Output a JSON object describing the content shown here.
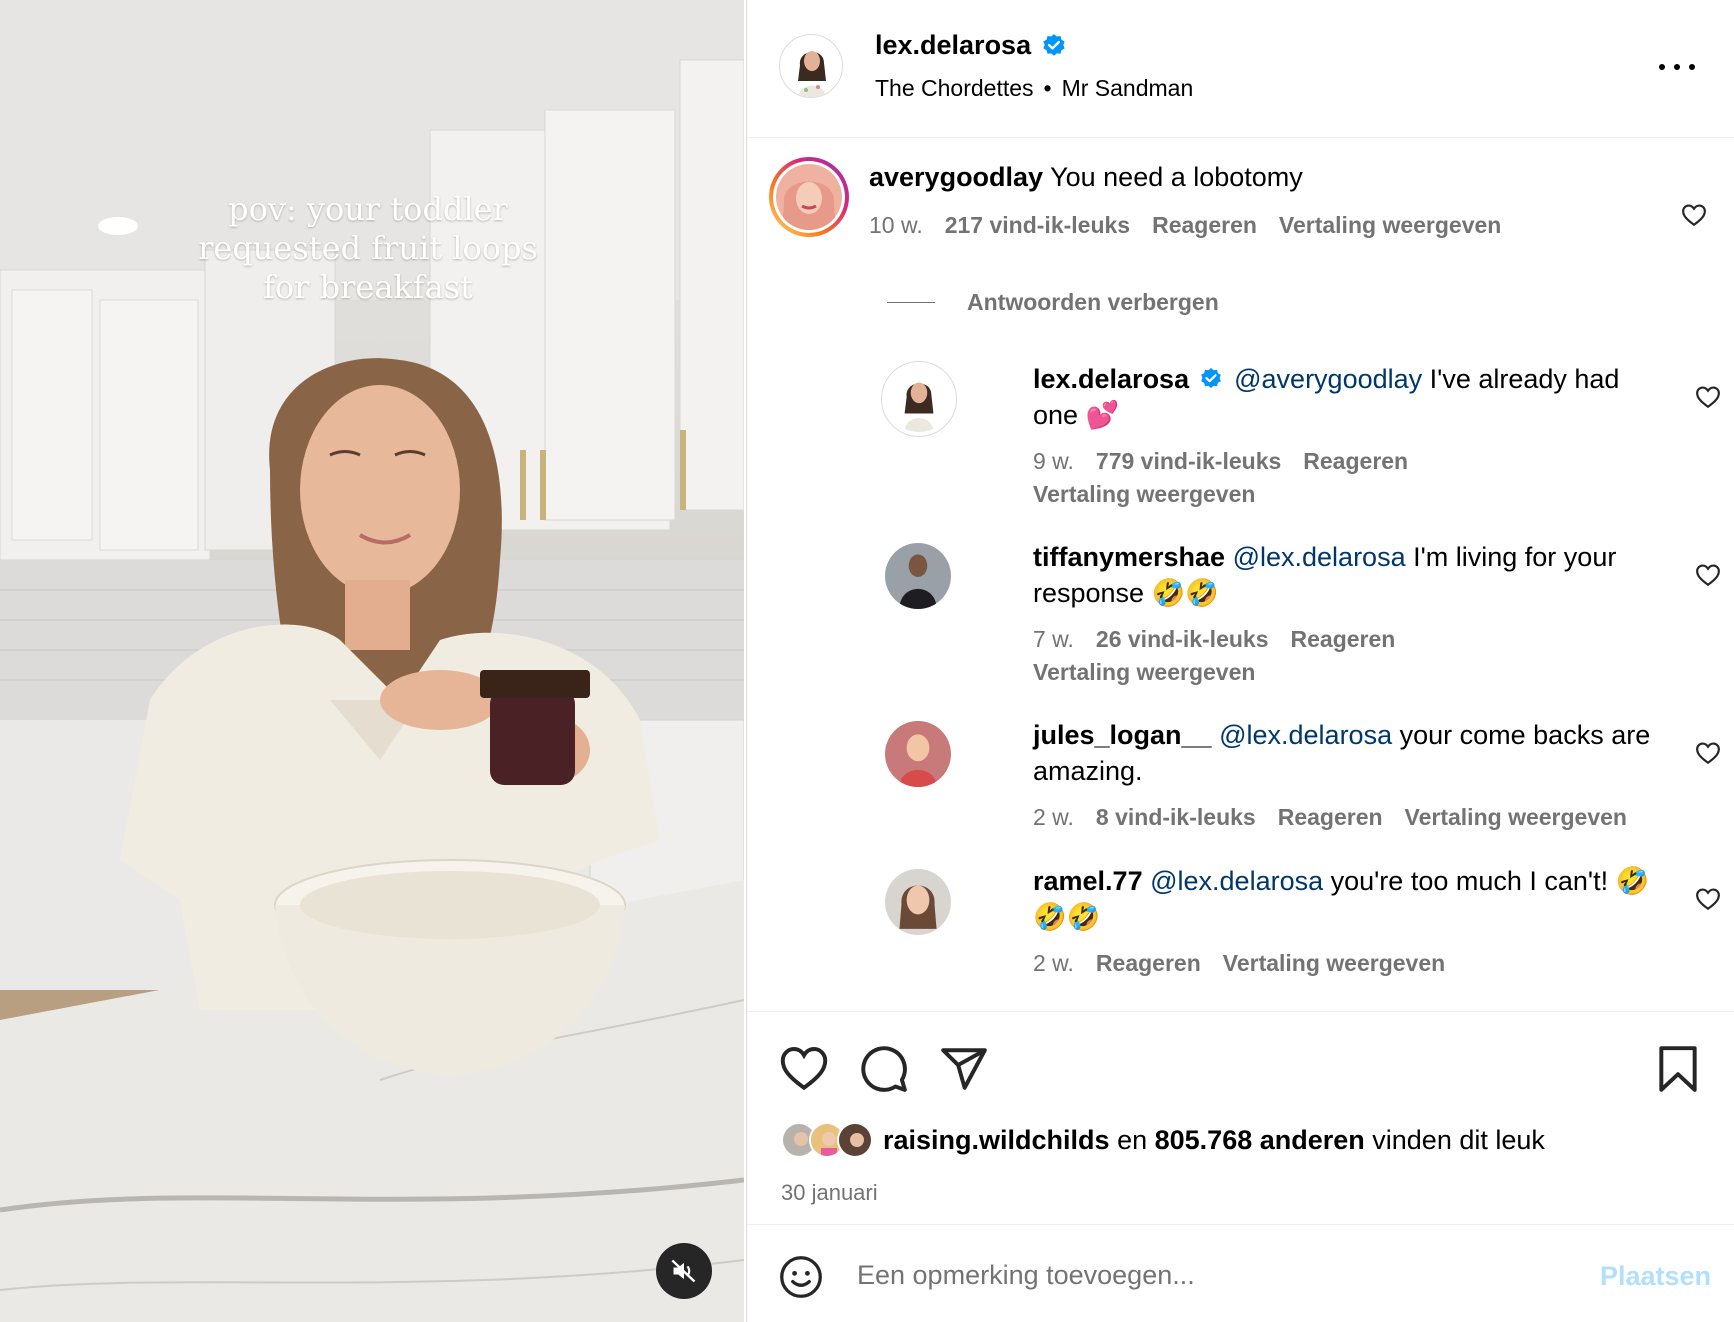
{
  "video": {
    "overlay_caption": "pov: your toddler requested fruit loops for breakfast",
    "mute_icon": "speaker-muted-icon"
  },
  "header": {
    "username": "lex.delarosa",
    "verified": true,
    "music_artist": "The Chordettes",
    "music_separator": "•",
    "music_song": "Mr Sandman",
    "more_icon": "more-horizontal-icon"
  },
  "comments": {
    "top": {
      "username": "averygoodlay",
      "text": "You need a lobotomy",
      "time": "10 w.",
      "likes": "217 vind-ik-leuks",
      "reply": "Reageren",
      "translate": "Vertaling weergeven"
    },
    "hide_replies": "Antwoorden verbergen",
    "replies": [
      {
        "username": "lex.delarosa",
        "verified": true,
        "mention": "@averygoodlay",
        "text": "I've already had one 💕",
        "time": "9 w.",
        "likes": "779 vind-ik-leuks",
        "reply": "Reageren",
        "translate": "Vertaling weergeven"
      },
      {
        "username": "tiffanymershae",
        "mention": "@lex.delarosa",
        "text": "I'm living for your response 🤣🤣",
        "time": "7 w.",
        "likes": "26 vind-ik-leuks",
        "reply": "Reageren",
        "translate": "Vertaling weergeven"
      },
      {
        "username": "jules_logan__",
        "mention": "@lex.delarosa",
        "text": "your come backs are amazing.",
        "time": "2 w.",
        "likes": "8 vind-ik-leuks",
        "reply": "Reageren",
        "translate": "Vertaling weergeven"
      },
      {
        "username": "ramel.77",
        "mention": "@lex.delarosa",
        "text": "you're too much I can't! 🤣🤣🤣",
        "time": "2 w.",
        "reply": "Reageren",
        "translate": "Vertaling weergeven"
      }
    ]
  },
  "actions": {
    "like_icon": "heart-icon",
    "comment_icon": "comment-bubble-icon",
    "share_icon": "paper-plane-icon",
    "save_icon": "bookmark-icon",
    "liked_by_user": "raising.wildchilds",
    "liked_by_connector": "en",
    "liked_by_others": "805.768 anderen",
    "liked_by_suffix": "vinden dit leuk",
    "date": "30 januari"
  },
  "composer": {
    "placeholder": "Een opmerking toevoegen...",
    "post_label": "Plaatsen",
    "emoji_icon": "smiley-icon"
  },
  "colors": {
    "link": "#00376b",
    "secondary_text": "#737373",
    "verified_blue": "#0095f6",
    "post_disabled": "#b2dffc",
    "story_ring": [
      "#feda75",
      "#d62976",
      "#962fbf"
    ]
  }
}
